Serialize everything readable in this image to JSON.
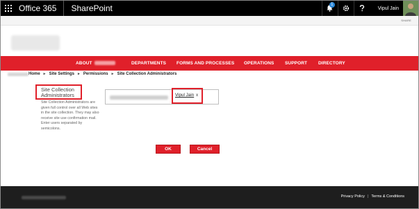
{
  "suite_bar": {
    "brand": "Office 365",
    "app_name": "SharePoint",
    "notification_count": "1",
    "user_name": "Vipul Jain",
    "icons": [
      "app-launcher-icon",
      "bell-icon",
      "gear-icon",
      "help-icon"
    ]
  },
  "ribbon": {
    "share_label": "SHARE"
  },
  "nav": {
    "items": [
      {
        "label": "ABOUT"
      },
      {
        "label": "DEPARTMENTS"
      },
      {
        "label": "FORMS AND PROCESSES"
      },
      {
        "label": "OPERATIONS"
      },
      {
        "label": "SUPPORT"
      },
      {
        "label": "DIRECTORY"
      }
    ]
  },
  "breadcrumb": {
    "items": [
      "Home",
      "Site Settings",
      "Permissions",
      "Site Collection Administrators"
    ]
  },
  "section": {
    "title": "Site Collection Administrators",
    "description": "Site Collection Administrators are given full control over all Web sites in the site collection. They may also receive site use confirmation mail. Enter users separated by semicolons."
  },
  "picker": {
    "user": "Vipul Jain",
    "remove_label": "x"
  },
  "buttons": {
    "ok": "OK",
    "cancel": "Cancel"
  },
  "footer": {
    "privacy": "Privacy Policy",
    "terms": "Terms & Conditions",
    "separator": "|"
  },
  "colors": {
    "brand_red": "#e0202a",
    "suite_black": "#000000",
    "footer_dark": "#1e1e1e"
  }
}
